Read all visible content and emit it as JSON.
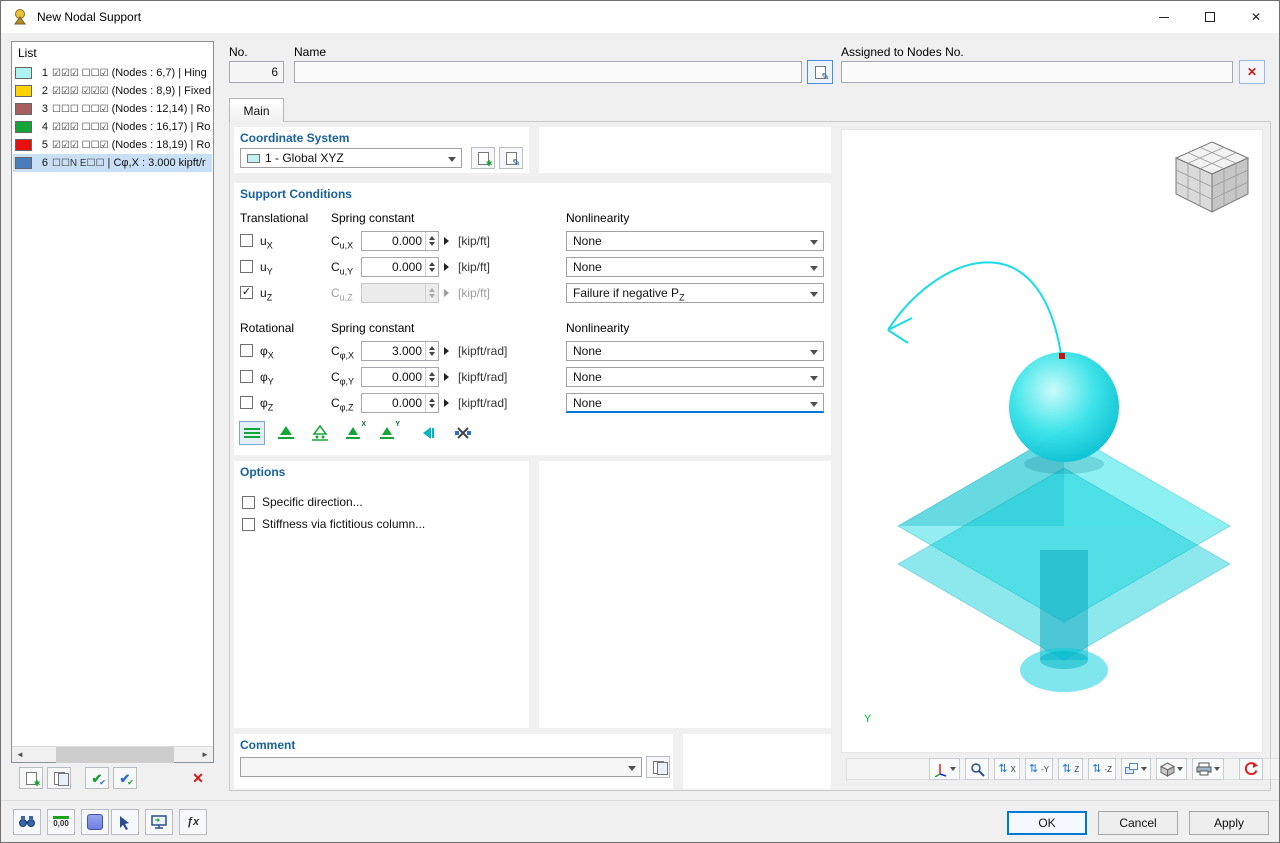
{
  "window": {
    "title": "New Nodal Support"
  },
  "icons": {
    "pencil": "✎",
    "star": "✱",
    "check": "✔",
    "close": "✕",
    "delete": "✕",
    "scroll_left": "◄",
    "scroll_right": "►",
    "updown": "⇅",
    "function": "ƒx",
    "axis_x": "X",
    "axis_y": "Y"
  },
  "list": {
    "header": "List",
    "items": [
      {
        "num": "1",
        "color": "#aef3ef",
        "flags": "☑☑☑ ☐☐☑",
        "text": "(Nodes : 6,7) | Hing"
      },
      {
        "num": "2",
        "color": "#ffd400",
        "flags": "☑☑☑ ☑☑☑",
        "text": "(Nodes : 8,9) | Fixed"
      },
      {
        "num": "3",
        "color": "#a85f5f",
        "flags": "☐☐☐ ☐☐☑",
        "text": "(Nodes : 12,14) | Ro"
      },
      {
        "num": "4",
        "color": "#13a537",
        "flags": "☑☑☑ ☐☐☑",
        "text": "(Nodes : 16,17) | Ro"
      },
      {
        "num": "5",
        "color": "#e8100c",
        "flags": "☑☑☑ ☐☐☑",
        "text": "(Nodes : 18,19) | Ro"
      },
      {
        "num": "6",
        "color": "#4a7ebb",
        "flags": "☐☐N E☐☐",
        "text": "| Cφ,X : 3.000 kipft/r"
      }
    ]
  },
  "header": {
    "no_label": "No.",
    "no_value": "6",
    "name_label": "Name",
    "name_value": "",
    "assigned_label": "Assigned to Nodes No.",
    "assigned_value": ""
  },
  "tab": {
    "label": "Main"
  },
  "coordinate_system": {
    "header": "Coordinate System",
    "selected": "1 - Global XYZ"
  },
  "support": {
    "header": "Support Conditions",
    "translational_label": "Translational",
    "rotational_label": "Rotational",
    "spring_label": "Spring constant",
    "nonlinearity_label": "Nonlinearity",
    "t_rows": [
      {
        "checked": false,
        "dof": "u",
        "dof_sub": "X",
        "c": "C",
        "c_sub": "u,X",
        "value": "0.000",
        "unit": "[kip/ft]",
        "nonlin": "None",
        "nonlin_sub": ""
      },
      {
        "checked": false,
        "dof": "u",
        "dof_sub": "Y",
        "c": "C",
        "c_sub": "u,Y",
        "value": "0.000",
        "unit": "[kip/ft]",
        "nonlin": "None",
        "nonlin_sub": ""
      },
      {
        "checked": true,
        "dof": "u",
        "dof_sub": "Z",
        "c": "C",
        "c_sub": "u,Z",
        "value": "",
        "unit": "[kip/ft]",
        "nonlin": "Failure if negative P",
        "nonlin_sub": "Z"
      }
    ],
    "r_rows": [
      {
        "checked": false,
        "dof": "φ",
        "dof_sub": "X",
        "c": "C",
        "c_sub": "φ,X",
        "value": "3.000",
        "unit": "[kipft/rad]",
        "nonlin": "None",
        "nonlin_sub": ""
      },
      {
        "checked": false,
        "dof": "φ",
        "dof_sub": "Y",
        "c": "C",
        "c_sub": "φ,Y",
        "value": "0.000",
        "unit": "[kipft/rad]",
        "nonlin": "None",
        "nonlin_sub": ""
      },
      {
        "checked": false,
        "dof": "φ",
        "dof_sub": "Z",
        "c": "C",
        "c_sub": "φ,Z",
        "value": "0.000",
        "unit": "[kipft/rad]",
        "nonlin": "None",
        "nonlin_sub": ""
      }
    ]
  },
  "options": {
    "header": "Options",
    "specific_direction": "Specific direction...",
    "fictitious_column": "Stiffness via fictitious column..."
  },
  "comment": {
    "header": "Comment",
    "value": ""
  },
  "viewport": {
    "axis_label": "Y",
    "toolbar_axes": [
      "X",
      "-Y",
      "Z",
      "-Z"
    ]
  },
  "footer": {
    "ok": "OK",
    "cancel": "Cancel",
    "apply": "Apply",
    "decimal_button": "0,00"
  }
}
